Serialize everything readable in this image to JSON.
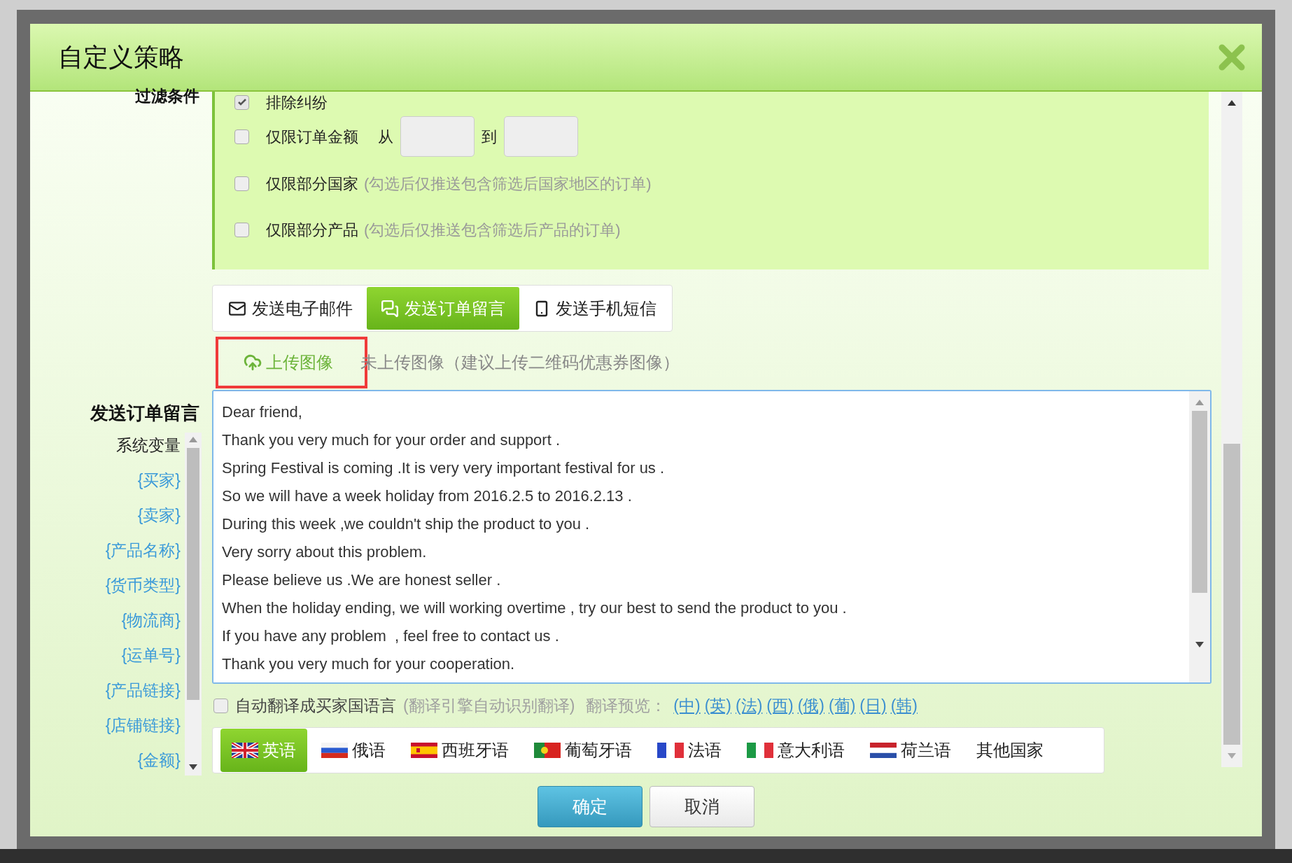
{
  "dialog": {
    "title": "自定义策略"
  },
  "filters": {
    "label": "过滤条件",
    "items": [
      {
        "kind": "checkbox",
        "label": "排除纠纷",
        "checked": true
      },
      {
        "kind": "range",
        "label": "仅限订单金额",
        "from_label": "从",
        "to_label": "到",
        "checked": false
      },
      {
        "kind": "checkbox",
        "label": "仅限部分国家",
        "hint": "(勾选后仅推送包含筛选后国家地区的订单)",
        "checked": false
      },
      {
        "kind": "checkbox",
        "label": "仅限部分产品",
        "hint": "(勾选后仅推送包含筛选后产品的订单)",
        "checked": false
      }
    ]
  },
  "send_tabs": [
    {
      "kind": "email",
      "label": "发送电子邮件",
      "selected": false
    },
    {
      "kind": "message",
      "label": "发送订单留言",
      "selected": true
    },
    {
      "kind": "sms",
      "label": "发送手机短信",
      "selected": false
    }
  ],
  "upload": {
    "button": "上传图像",
    "status": "未上传图像（建议上传二维码优惠券图像）"
  },
  "message": {
    "label": "发送订单留言",
    "variables_title": "系统变量",
    "variables": [
      "{买家}",
      "{卖家}",
      "{产品名称}",
      "{货币类型}",
      "{物流商}",
      "{运单号}",
      "{产品链接}",
      "{店铺链接}",
      "{金额}"
    ],
    "lines": [
      "Dear friend,",
      "Thank you very much for your order and support .",
      "Spring Festival is coming .It is very very important festival for us .",
      "So we will have a week holiday from 2016.2.5 to 2016.2.13 .",
      "During this week ,we couldn't ship the product to you .",
      "Very sorry about this problem.",
      "Please believe us .We are honest seller .",
      "When the holiday ending, we will working overtime , try our best to send the product to you .",
      "If you have any problem  , feel free to contact us .",
      "Thank you very much for your cooperation."
    ]
  },
  "translate": {
    "checked": false,
    "label": "自动翻译成买家国语言",
    "hint": "(翻译引擎自动识别翻译)",
    "preview_label": "翻译预览：",
    "links": [
      "(中)",
      "(英)",
      "(法)",
      "(西)",
      "(俄)",
      "(葡)",
      "(日)",
      "(韩)"
    ]
  },
  "languages": [
    {
      "kind": "uk",
      "label": "英语",
      "selected": true
    },
    {
      "kind": "russia",
      "label": "俄语",
      "selected": false
    },
    {
      "kind": "spain",
      "label": "西班牙语",
      "selected": false
    },
    {
      "kind": "portugal",
      "label": "葡萄牙语",
      "selected": false
    },
    {
      "kind": "france",
      "label": "法语",
      "selected": false
    },
    {
      "kind": "italy",
      "label": "意大利语",
      "selected": false
    },
    {
      "kind": "netherlands",
      "label": "荷兰语",
      "selected": false
    },
    {
      "kind": "other",
      "label": "其他国家",
      "selected": false
    }
  ],
  "buttons": [
    {
      "kind": "primary",
      "label": "确定"
    },
    {
      "kind": "default",
      "label": "取消"
    }
  ]
}
